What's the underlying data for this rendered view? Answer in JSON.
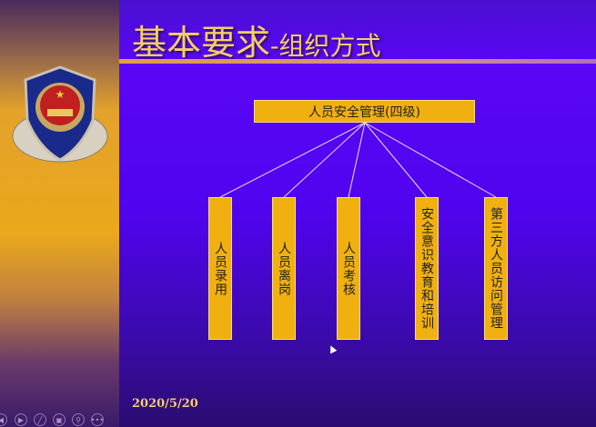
{
  "slide": {
    "title_main": "基本要求",
    "title_sub": "-组织方式",
    "date": "2020/5/20"
  },
  "org": {
    "root": "人员安全管理(四级)",
    "children": [
      "人员录用",
      "人员离岗",
      "人员考核",
      "安全意识教育和培训",
      "第三方人员访问管理"
    ]
  },
  "controls": [
    "previous-icon",
    "next-icon",
    "pen-icon",
    "slides-icon",
    "zoom-icon",
    "more-icon"
  ],
  "colors": {
    "box": "#f0b010",
    "title": "#f6cc6a",
    "background": "#5004ee"
  }
}
